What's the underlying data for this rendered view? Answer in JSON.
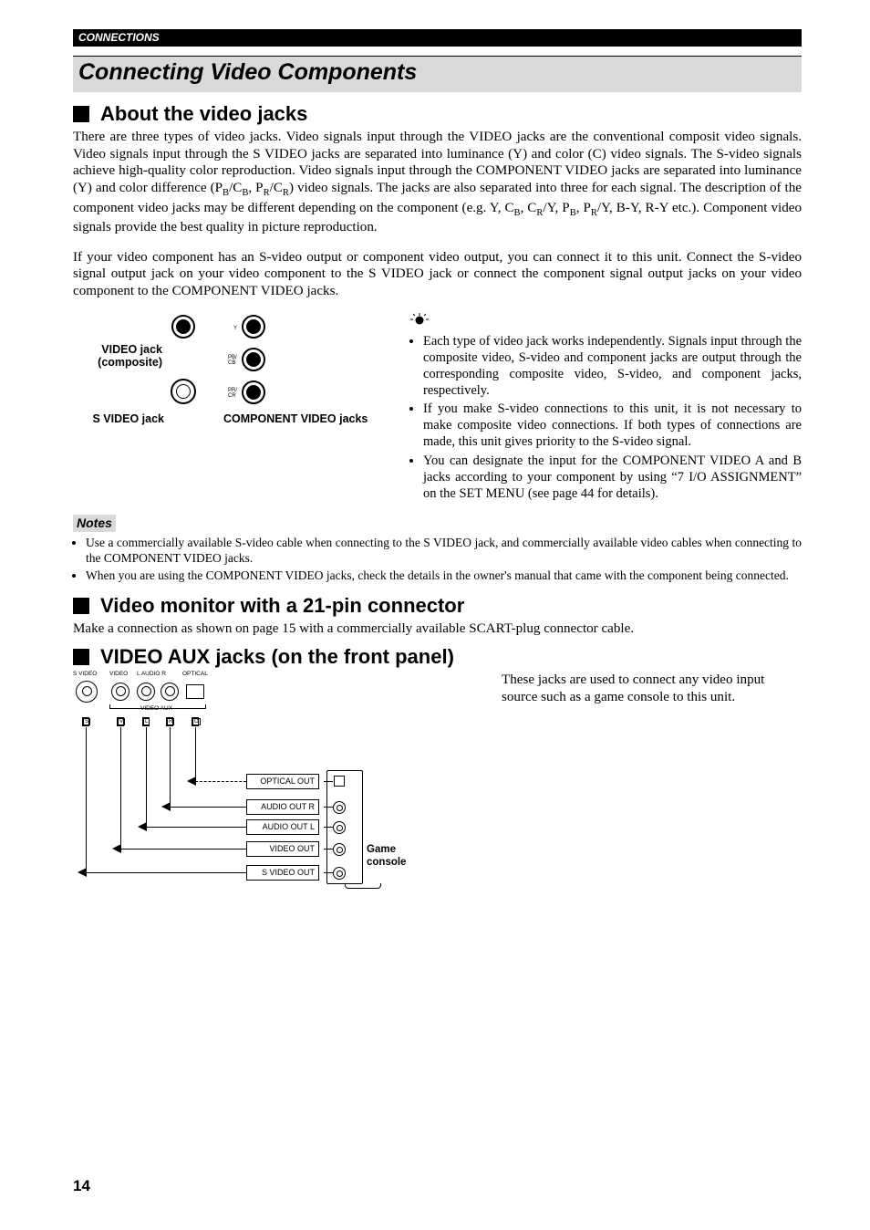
{
  "header": {
    "section": "CONNECTIONS"
  },
  "title": "Connecting Video Components",
  "s1": {
    "heading": "About the video jacks",
    "p1": "There are three types of video jacks. Video signals input through the VIDEO jacks are the conventional composit video signals. Video signals input through the S VIDEO jacks are separated into luminance (Y) and color (C) video signals. The S-video signals achieve high-quality color reproduction. Video signals input through the COMPONENT VIDEO jacks are separated into luminance (Y) and color difference (P",
    "p1b": "/C",
    "p1c": ", P",
    "p1d": "/C",
    "p1e": ") video signals. The jacks are also separated into three for each signal. The description of the component video jacks may be different depending on the component (e.g. Y, C",
    "p1f": ", C",
    "p1g": "/Y, P",
    "p1h": ", P",
    "p1i": "/Y, B-Y, R-Y etc.). Component video signals provide the best quality in picture reproduction.",
    "p2": "If your video component has an S-video output or component video output, you can connect it to this unit. Connect the S-video signal output jack on your video component to the S VIDEO jack or connect the component signal output jacks on your video component to the COMPONENT VIDEO jacks.",
    "illus": {
      "video_label": "VIDEO jack (composite)",
      "svideo_label": "S VIDEO jack",
      "component_label": "COMPONENT VIDEO jacks",
      "y": "Y",
      "pb": "PB/",
      "cb": "CB",
      "pr": "PR/",
      "cr": "CR"
    },
    "tips": {
      "t1": "Each type of video jack works independently. Signals input through the composite video, S-video and component jacks are output through the corresponding composite video, S-video, and component jacks, respectively.",
      "t2": "If you make S-video connections to this unit, it is not necessary to make composite video connections. If both types of connections are made, this unit gives priority to the S-video signal.",
      "t3": "You can designate the input for the COMPONENT VIDEO A and B jacks according to your component by using “7 I/O ASSIGNMENT” on the SET MENU (see page 44 for details)."
    }
  },
  "notes": {
    "label": "Notes",
    "n1": "Use a commercially available S-video cable when connecting to the S VIDEO jack, and commercially available video cables when connecting to the COMPONENT VIDEO jacks.",
    "n2": "When you are using the COMPONENT VIDEO jacks, check the details in the owner's manual that came with the component being connected."
  },
  "s2": {
    "heading": "Video monitor with a 21-pin connector",
    "p1": "Make a connection as shown on page 15 with a commercially available SCART-plug connector cable."
  },
  "s3": {
    "heading": "VIDEO AUX jacks (on the front panel)",
    "p1": "These jacks are used to connect any video input source such as a game console to this unit.",
    "illus": {
      "svideo": "S VIDEO",
      "video": "VIDEO",
      "laudior": "L  AUDIO  R",
      "optical": "OPTICAL",
      "videoaux": "VIDEO AUX",
      "pin_s": "S",
      "pin_v": "V",
      "pin_l": "L",
      "pin_r": "R",
      "pin_o": "O",
      "opt_out": "OPTICAL OUT",
      "aud_r": "AUDIO OUT R",
      "aud_l": "AUDIO OUT L",
      "vid_out": "VIDEO OUT",
      "svid_out": "S VIDEO OUT",
      "console": "Game console"
    }
  },
  "pagenum": "14"
}
